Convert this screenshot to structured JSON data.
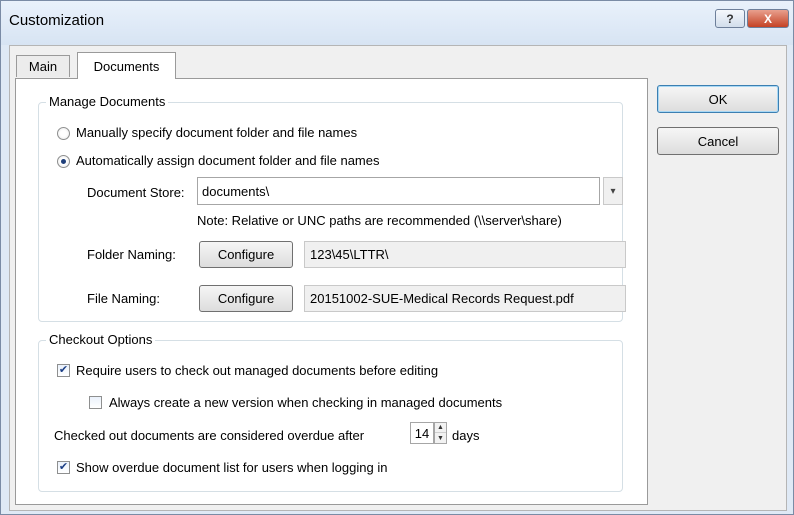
{
  "window": {
    "title": "Customization",
    "help_label": "?",
    "close_label": "X"
  },
  "tabs": [
    {
      "label": "Main",
      "active": false
    },
    {
      "label": "Documents",
      "active": true
    }
  ],
  "manage_documents": {
    "group_label": "Manage Documents",
    "options": [
      {
        "label": "Manually specify document folder and file names",
        "selected": false
      },
      {
        "label": "Automatically assign document folder and file names",
        "selected": true
      }
    ],
    "document_store_label": "Document Store:",
    "document_store_value": "documents\\",
    "dropdown_glyph": "▾",
    "note": "Note:  Relative or UNC paths are recommended (\\\\server\\share)",
    "folder_naming_label": "Folder Naming:",
    "folder_naming_button": "Configure",
    "folder_naming_value": "123\\45\\LTTR\\",
    "file_naming_label": "File Naming:",
    "file_naming_button": "Configure",
    "file_naming_value": "20151002-SUE-Medical Records Request.pdf"
  },
  "checkout_options": {
    "group_label": "Checkout Options",
    "require_checkout_label": "Require users to check out managed documents before editing",
    "require_checkout_checked": true,
    "new_version_label": "Always create a new version when checking in managed documents",
    "new_version_checked": false,
    "overdue_prefix": "Checked out documents are considered overdue after",
    "overdue_days": "14",
    "overdue_suffix": "days",
    "show_overdue_label": "Show overdue document list for users when logging in",
    "show_overdue_checked": true
  },
  "buttons": {
    "ok": "OK",
    "cancel": "Cancel"
  },
  "glyphs": {
    "check": "✔",
    "up": "▲",
    "down": "▼"
  },
  "colors": {
    "titlebar": "#dfe9f5",
    "close_button": "#c54224",
    "panel": "#ffffff"
  }
}
